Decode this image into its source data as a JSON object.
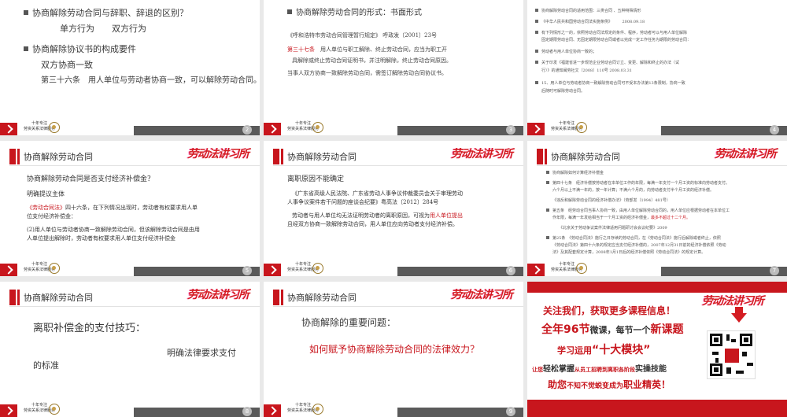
{
  "footer": {
    "brand_line1": "十年专注",
    "brand_line2": "劳资关系法律服务"
  },
  "logo_text": "劳动法讲习所",
  "slide1": {
    "page": "2",
    "h1": "协商解除劳动合同与辞职、辞退的区别？",
    "h1_items": "单方行为　　双方行为",
    "h2": "协商解除协议书的构成要件",
    "h2_item1": "双方协商一致",
    "h2_item2": "第三十六条　用人单位与劳动者协商一致，可以解除劳动合同。"
  },
  "slide2": {
    "page": "3",
    "h1": "协商解除劳动合同的形式：书面形式",
    "l1": "《呼和浩特市劳动合同管理暂行规定》 呼政发〔2001〕23号",
    "l2_red": "第三十七条",
    "l2": "　用人单位与职工解除、终止劳动合同，应当为职工开",
    "l3": "具解除或终止劳动合同证明书，并注明解除，终止劳动合同原因。",
    "l4": "当事人双方协商一致解除劳动合同，需签订解除劳动合同协议书。"
  },
  "slide3": {
    "page": "4",
    "lines": [
      "协商解除劳动合同的适用范围：三类合同 、五种特殊情形",
      "《中华人民共和国劳动合同法实施条例》　　　2008.09.18",
      "有下列情形之一的，依照劳动合同法规定的条件、程序，劳动者可以与用人单位解除",
      "固定期限劳动合同、无固定期限劳动合同或者以完成一定工作任务为期限的劳动合同：",
      "劳动者与用人单位协商一致的；",
      "关于印发《福建省进一步规范企业劳动合同订立、变更、解除和终止的办法（试",
      "行）》的通知闽劳社文〔2008〕110号  2008.03.31",
      "15、用人单位与劳动者协商一致解除劳动合同可不受本办法第13条限制，协商一致",
      "后随时可解除劳动合同。"
    ]
  },
  "slide4": {
    "page": "5",
    "title": "协商解除劳动合同",
    "q": "协商解除劳动合同是否支付经济补偿金？",
    "a1": "明确提议主体",
    "a2_red": "《劳动合同法》",
    "a2": "四十六条，在下列情况出现时，劳动者有权要求用人单",
    "a3": "位支付经济补偿金：",
    "a4": "(2)用人单位与劳动者协商一致解除劳动合同，但该解除劳动合同是由用",
    "a5": "人单位提出解除时，劳动者有权要求用人单位支付经济补偿金"
  },
  "slide5": {
    "page": "6",
    "title": "协商解除劳动合同",
    "q": "离职原因不能确定",
    "b1": "《广东省高级人民法院、广东省劳动人事争议仲裁委员会关于审理劳动",
    "b2": "人事争议案件若干问题的座谈会纪要》粤高法〔2012〕284号",
    "b3": "劳动者与用人单位均无法证明劳动者的离职原因，可视为",
    "b3_red": "用人单位提出",
    "b4": "且经双方协商一致解除劳动合同，用人单位应向劳动者支付经济补偿。"
  },
  "slide6": {
    "page": "7",
    "title": "协商解除劳动合同",
    "lines": [
      "协商解除如何计算经济补偿金",
      "第四十七条　经济补偿按劳动者在本单位工作的年限，每满一年支付一个月工资的标准向劳动者支付。",
      "六个月以上不满一年的，按一年计算；不满六个月的，向劳动者支付半个月工资的经济补偿。",
      "《违反和解除劳动合同的经济补偿办法》（劳部发〔1994〕481号）",
      "第五条　经劳动合同当事人协商一致，由用人单位解除劳动合同的，用人单位应根据劳动者在本单位工",
      "作年限，每满一年发给相当于一个月工资的经济补偿金，",
      "最多不超过十二个月。",
      "《北京关于劳动争议案件法律适用问题研讨会会议纪要》2009",
      "第25条　《劳动合同法》施行之日存续的劳动合同，在《劳动合同法》施行后解除或者终止，依照",
      "《劳动合同法》第四十六条的规定应当支付经济补偿的，2007年12月31日前的经济补偿依照《劳动",
      "法》及其配套规定计算，2008年1月1日后的经济补偿依照《劳动合同法》的规定计算。"
    ]
  },
  "slide7": {
    "page": "8",
    "title": "协商解除劳动合同",
    "l1": "离职补偿金的支付技巧：",
    "l2": "明确法律要求支付",
    "l3": "的标准"
  },
  "slide8": {
    "page": "9",
    "title": "协商解除劳动合同",
    "l1": "协商解除的重要问题：",
    "l2": "如何赋予协商解除劳动合同的法律效力？"
  },
  "promo": {
    "line1": "关注我们，获取更多课程信息！",
    "line2a": "全年96节",
    "line2b": "微课，每节一个",
    "line2c": "新课题",
    "line3a": "学习运用",
    "line3b": "“十大模块”",
    "line4a": "让您",
    "line4b": "轻松掌握",
    "line4c": "从员工招聘到离职各阶段",
    "line4d": "实操技能",
    "line5a": "助您",
    "line5b": "不知不觉蜕变成为",
    "line5c": "职业精英",
    "line5d": "！"
  },
  "colors": {
    "accent": "#c8161d",
    "footer_gray": "#5a5a5a"
  }
}
